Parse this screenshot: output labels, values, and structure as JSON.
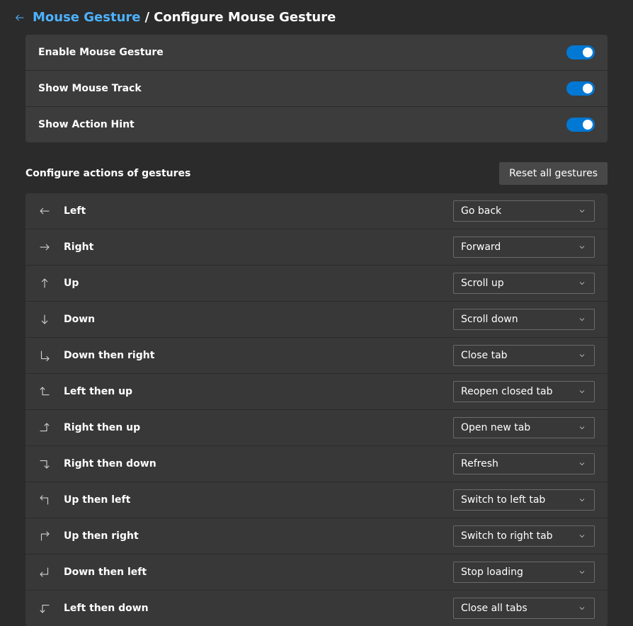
{
  "breadcrumb": {
    "parent": "Mouse Gesture",
    "current": "Configure Mouse Gesture"
  },
  "toggles": [
    {
      "label": "Enable Mouse Gesture",
      "on": true
    },
    {
      "label": "Show Mouse Track",
      "on": true
    },
    {
      "label": "Show Action Hint",
      "on": true
    }
  ],
  "section": {
    "title": "Configure actions of gestures",
    "reset_label": "Reset all gestures"
  },
  "gestures": [
    {
      "icon": "arrow-left",
      "name": "Left",
      "action": "Go back"
    },
    {
      "icon": "arrow-right",
      "name": "Right",
      "action": "Forward"
    },
    {
      "icon": "arrow-up",
      "name": "Up",
      "action": "Scroll up"
    },
    {
      "icon": "arrow-down",
      "name": "Down",
      "action": "Scroll down"
    },
    {
      "icon": "down-right",
      "name": "Down then right",
      "action": "Close tab"
    },
    {
      "icon": "left-up",
      "name": "Left then up",
      "action": "Reopen closed tab"
    },
    {
      "icon": "right-up",
      "name": "Right then up",
      "action": "Open new tab"
    },
    {
      "icon": "right-down",
      "name": "Right then down",
      "action": "Refresh"
    },
    {
      "icon": "up-left",
      "name": "Up then left",
      "action": "Switch to left tab"
    },
    {
      "icon": "up-right",
      "name": "Up then right",
      "action": "Switch to right tab"
    },
    {
      "icon": "down-left",
      "name": "Down then left",
      "action": "Stop loading"
    },
    {
      "icon": "left-down",
      "name": "Left then down",
      "action": "Close all tabs"
    }
  ]
}
